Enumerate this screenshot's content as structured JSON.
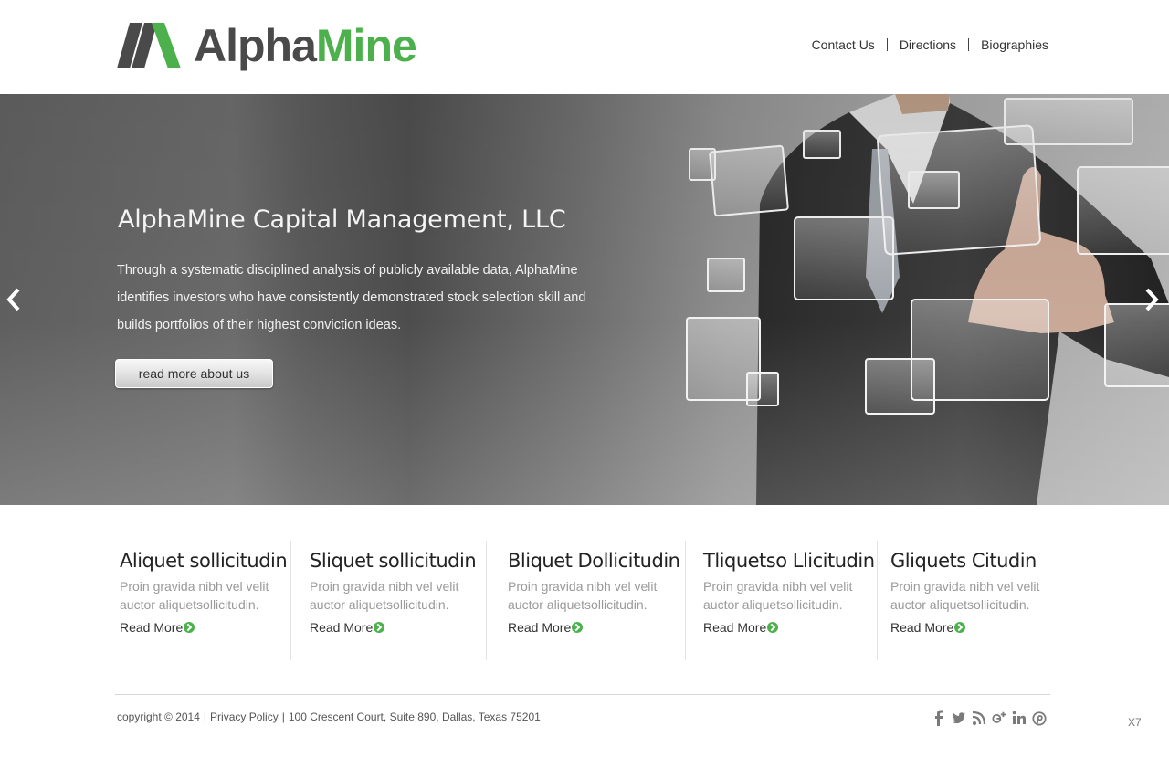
{
  "header": {
    "logo_text_1": "Alpha",
    "logo_text_2": "Mine",
    "nav": [
      "Contact Us",
      "Directions",
      "Biographies"
    ]
  },
  "hero": {
    "title": "AlphaMine Capital Management, LLC",
    "text": "Through a systematic disciplined analysis of publicly available data, AlphaMine identifies investors who have consistently demonstrated stock selection skill and builds portfolios of their highest conviction ideas.",
    "button": "read more about us"
  },
  "features": [
    {
      "title": "Aliquet sollicitudin",
      "text": "Proin gravida nibh vel velit auctor aliquetsollicitudin.",
      "link": "Read More"
    },
    {
      "title": "Sliquet sollicitudin",
      "text": "Proin gravida nibh vel velit auctor aliquetsollicitudin.",
      "link": "Read More"
    },
    {
      "title": "Bliquet Dollicitudin",
      "text": "Proin gravida nibh vel velit auctor aliquetsollicitudin.",
      "link": "Read More"
    },
    {
      "title": "Tliquetso Llicitudin",
      "text": "Proin gravida nibh vel velit auctor aliquetsollicitudin.",
      "link": "Read More"
    },
    {
      "title": "Gliquets Citudin",
      "text": "Proin gravida nibh vel velit auctor aliquetsollicitudin.",
      "link": "Read More"
    }
  ],
  "footer": {
    "copyright": "copyright © 2014",
    "privacy": "Privacy Policy",
    "address": "100 Crescent Court, Suite 890, Dallas, Texas 75201",
    "social_icons": [
      "facebook-icon",
      "twitter-icon",
      "rss-icon",
      "google-plus-icon",
      "linkedin-icon",
      "pinterest-icon"
    ],
    "corner": "X7"
  },
  "colors": {
    "brand_green": "#4cb14c",
    "logo_gray": "#4a4a4a"
  }
}
